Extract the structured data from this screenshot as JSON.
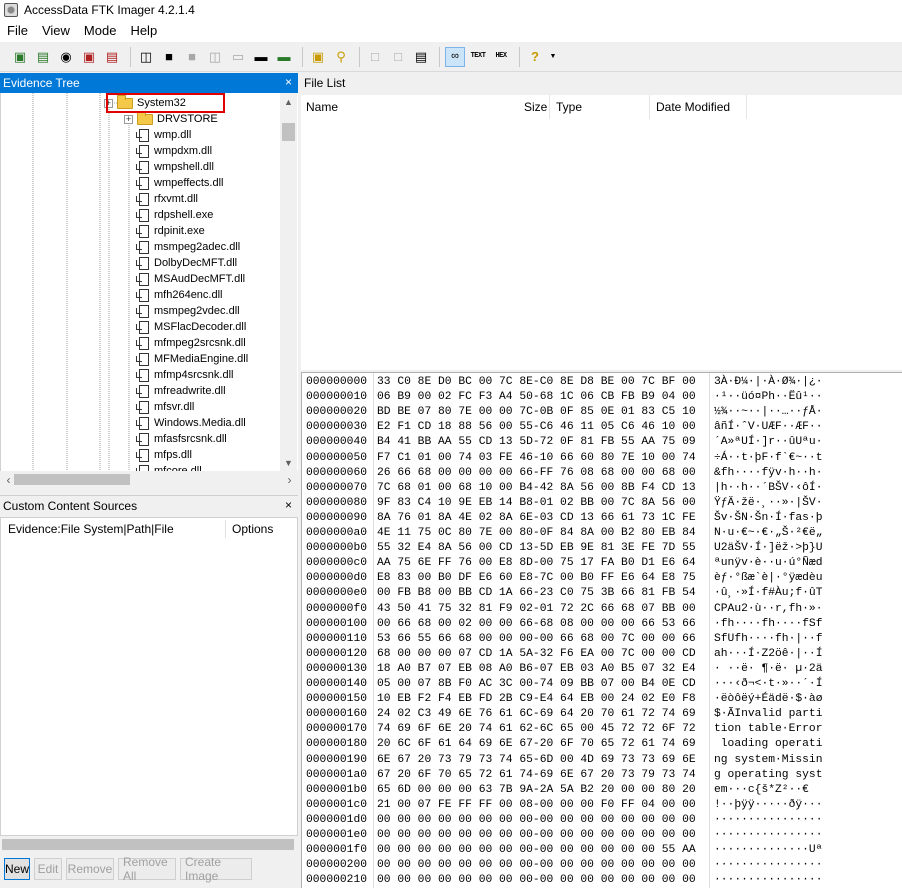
{
  "window": {
    "title": "AccessData FTK Imager 4.2.1.4"
  },
  "menu": [
    "File",
    "View",
    "Mode",
    "Help"
  ],
  "toolbar": {
    "text_view_label": "TEXT",
    "hex_view_label": "HEX"
  },
  "evidence_tree": {
    "header": "Evidence Tree",
    "close": "×",
    "highlighted": "System32",
    "folders": [
      {
        "label": "System32",
        "expand": "+"
      },
      {
        "label": "DRVSTORE",
        "expand": "+"
      }
    ],
    "files": [
      "wmp.dll",
      "wmpdxm.dll",
      "wmpshell.dll",
      "wmpeffects.dll",
      "rfxvmt.dll",
      "rdpshell.exe",
      "rdpinit.exe",
      "msmpeg2adec.dll",
      "DolbyDecMFT.dll",
      "MSAudDecMFT.dll",
      "mfh264enc.dll",
      "msmpeg2vdec.dll",
      "MSFlacDecoder.dll",
      "mfmpeg2srcsnk.dll",
      "MFMediaEngine.dll",
      "mfmp4srcsnk.dll",
      "mfreadwrite.dll",
      "mfsvr.dll",
      "Windows.Media.dll",
      "mfasfsrcsnk.dll",
      "mfps.dll",
      "mfcore.dll"
    ]
  },
  "custom_content": {
    "header": "Custom Content Sources",
    "close": "×",
    "col_evidence": "Evidence:File System|Path|File",
    "col_options": "Options",
    "buttons": {
      "new": "New",
      "edit": "Edit",
      "remove": "Remove",
      "remove_all": "Remove All",
      "create_image": "Create Image"
    }
  },
  "file_list": {
    "header": "File List",
    "columns": {
      "name": "Name",
      "size": "Size",
      "type": "Type",
      "date": "Date Modified"
    }
  },
  "hex": {
    "rows": [
      {
        "off": "000000000",
        "bytes": "33 C0 8E D0 BC 00 7C 8E-C0 8E D8 BE 00 7C BF 00",
        "ascii": "3À·Ð¼·|·À·Ø¾·|¿·"
      },
      {
        "off": "000000010",
        "bytes": "06 B9 00 02 FC F3 A4 50-68 1C 06 CB FB B9 04 00",
        "ascii": "·¹··üó¤Ph··Ëû¹··"
      },
      {
        "off": "000000020",
        "bytes": "BD BE 07 80 7E 00 00 7C-0B 0F 85 0E 01 83 C5 10",
        "ascii": "½¾··~··|··…··ƒÅ·"
      },
      {
        "off": "000000030",
        "bytes": "E2 F1 CD 18 88 56 00 55-C6 46 11 05 C6 46 10 00",
        "ascii": "âñÍ·ˆV·UÆF··ÆF··"
      },
      {
        "off": "000000040",
        "bytes": "B4 41 BB AA 55 CD 13 5D-72 0F 81 FB 55 AA 75 09",
        "ascii": "´A»ªUÍ·]r··ûUªu·"
      },
      {
        "off": "000000050",
        "bytes": "F7 C1 01 00 74 03 FE 46-10 66 60 80 7E 10 00 74",
        "ascii": "÷Á··t·þF·f`€~··t"
      },
      {
        "off": "000000060",
        "bytes": "26 66 68 00 00 00 00 66-FF 76 08 68 00 00 68 00",
        "ascii": "&fh····fÿv·h··h·"
      },
      {
        "off": "000000070",
        "bytes": "7C 68 01 00 68 10 00 B4-42 8A 56 00 8B F4 CD 13",
        "ascii": "|h··h··´BŠV·‹ôÍ·"
      },
      {
        "off": "000000080",
        "bytes": "9F 83 C4 10 9E EB 14 B8-01 02 BB 00 7C 8A 56 00",
        "ascii": "ŸƒÄ·žë·¸··»·|ŠV·"
      },
      {
        "off": "000000090",
        "bytes": "8A 76 01 8A 4E 02 8A 6E-03 CD 13 66 61 73 1C FE",
        "ascii": "Šv·ŠN·Šn·Í·fas·þ"
      },
      {
        "off": "0000000a0",
        "bytes": "4E 11 75 0C 80 7E 00 80-0F 84 8A 00 B2 80 EB 84",
        "ascii": "N·u·€~·€·„Š·²€ë„"
      },
      {
        "off": "0000000b0",
        "bytes": "55 32 E4 8A 56 00 CD 13-5D EB 9E 81 3E FE 7D 55",
        "ascii": "U2äŠV·Í·]ëž·>þ}U"
      },
      {
        "off": "0000000c0",
        "bytes": "AA 75 6E FF 76 00 E8 8D-00 75 17 FA B0 D1 E6 64",
        "ascii": "ªunÿv·è··u·ú°Ñæd"
      },
      {
        "off": "0000000d0",
        "bytes": "E8 83 00 B0 DF E6 60 E8-7C 00 B0 FF E6 64 E8 75",
        "ascii": "èƒ·°ßæ`è|·°ÿædèu"
      },
      {
        "off": "0000000e0",
        "bytes": "00 FB B8 00 BB CD 1A 66-23 C0 75 3B 66 81 FB 54",
        "ascii": "·û¸·»Í·f#Àu;f·ûT"
      },
      {
        "off": "0000000f0",
        "bytes": "43 50 41 75 32 81 F9 02-01 72 2C 66 68 07 BB 00",
        "ascii": "CPAu2·ù··r,fh·»·"
      },
      {
        "off": "000000100",
        "bytes": "00 66 68 00 02 00 00 66-68 08 00 00 00 66 53 66",
        "ascii": "·fh····fh····fSf"
      },
      {
        "off": "000000110",
        "bytes": "53 66 55 66 68 00 00 00-00 66 68 00 7C 00 00 66",
        "ascii": "SfUfh····fh·|··f"
      },
      {
        "off": "000000120",
        "bytes": "68 00 00 00 07 CD 1A 5A-32 F6 EA 00 7C 00 00 CD",
        "ascii": "ah···Í·Z2öê·|··Í"
      },
      {
        "off": "000000130",
        "bytes": "18 A0 B7 07 EB 08 A0 B6-07 EB 03 A0 B5 07 32 E4",
        "ascii": "· ··ë· ¶·ë· µ·2ä"
      },
      {
        "off": "000000140",
        "bytes": "05 00 07 8B F0 AC 3C 00-74 09 BB 07 00 B4 0E CD",
        "ascii": "···‹ð¬<·t·»··´·Í"
      },
      {
        "off": "000000150",
        "bytes": "10 EB F2 F4 EB FD 2B C9-E4 64 EB 00 24 02 E0 F8",
        "ascii": "·ëòôëý+Éädë·$·àø"
      },
      {
        "off": "000000160",
        "bytes": "24 02 C3 49 6E 76 61 6C-69 64 20 70 61 72 74 69",
        "ascii": "$·ÃInvalid parti"
      },
      {
        "off": "000000170",
        "bytes": "74 69 6F 6E 20 74 61 62-6C 65 00 45 72 72 6F 72",
        "ascii": "tion table·Error"
      },
      {
        "off": "000000180",
        "bytes": "20 6C 6F 61 64 69 6E 67-20 6F 70 65 72 61 74 69",
        "ascii": " loading operati"
      },
      {
        "off": "000000190",
        "bytes": "6E 67 20 73 79 73 74 65-6D 00 4D 69 73 73 69 6E",
        "ascii": "ng system·Missin"
      },
      {
        "off": "0000001a0",
        "bytes": "67 20 6F 70 65 72 61 74-69 6E 67 20 73 79 73 74",
        "ascii": "g operating syst"
      },
      {
        "off": "0000001b0",
        "bytes": "65 6D 00 00 00 63 7B 9A-2A 5A B2 20 00 00 80 20",
        "ascii": "em···c{š*Z²··€ "
      },
      {
        "off": "0000001c0",
        "bytes": "21 00 07 FE FF FF 00 08-00 00 00 F0 FF 04 00 00",
        "ascii": "!··þÿÿ·····ðÿ···"
      },
      {
        "off": "0000001d0",
        "bytes": "00 00 00 00 00 00 00 00-00 00 00 00 00 00 00 00",
        "ascii": "················"
      },
      {
        "off": "0000001e0",
        "bytes": "00 00 00 00 00 00 00 00-00 00 00 00 00 00 00 00",
        "ascii": "················"
      },
      {
        "off": "0000001f0",
        "bytes": "00 00 00 00 00 00 00 00-00 00 00 00 00 00 55 AA",
        "ascii": "··············Uª"
      },
      {
        "off": "000000200",
        "bytes": "00 00 00 00 00 00 00 00-00 00 00 00 00 00 00 00",
        "ascii": "················"
      },
      {
        "off": "000000210",
        "bytes": "00 00 00 00 00 00 00 00-00 00 00 00 00 00 00 00",
        "ascii": "················"
      }
    ]
  }
}
